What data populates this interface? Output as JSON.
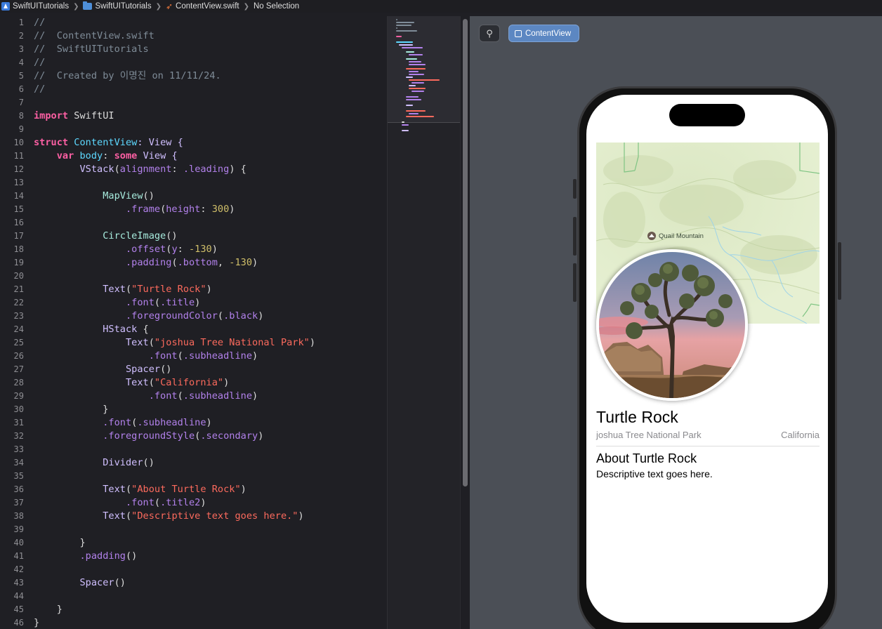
{
  "breadcrumb": {
    "project": "SwiftUITutorials",
    "folder": "SwiftUITutorials",
    "file": "ContentView.swift",
    "selection": "No Selection",
    "separator": "❯"
  },
  "editor": {
    "line_numbers": [
      "1",
      "2",
      "3",
      "4",
      "5",
      "6",
      "7",
      "8",
      "9",
      "10",
      "11",
      "12",
      "13",
      "14",
      "15",
      "16",
      "17",
      "18",
      "19",
      "20",
      "21",
      "22",
      "23",
      "24",
      "25",
      "26",
      "27",
      "28",
      "29",
      "30",
      "31",
      "32",
      "33",
      "34",
      "35",
      "36",
      "37",
      "38",
      "39",
      "40",
      "41",
      "42",
      "43",
      "44",
      "45",
      "46"
    ],
    "code": {
      "l1": "//",
      "l2": "//  ContentView.swift",
      "l3": "//  SwiftUITutorials",
      "l4": "//",
      "l5": "//  Created by 이명진 on 11/11/24.",
      "l6": "//",
      "import_kw": "import",
      "import_mod": "SwiftUI",
      "struct_kw": "struct",
      "struct_name": "ContentView",
      "colon_view": ": View {",
      "var_kw": "var",
      "body_name": "body",
      "some_kw": "some",
      "view_rest": "View {",
      "vstack": "VStack",
      "alignment_label": "alignment",
      "leading": ".leading",
      "mapview": "MapView",
      "frame": ".frame",
      "height_label": "height",
      "height_val": "300",
      "circleimage": "CircleImage",
      "offset": ".offset",
      "y_label": "y",
      "offset_val": "-130",
      "padding": ".padding",
      "bottom": ".bottom",
      "padding_val": "-130",
      "text_fn": "Text",
      "turtle_rock": "\"Turtle Rock\"",
      "font": ".font",
      "title": ".title",
      "fg_color": ".foregroundColor",
      "black": ".black",
      "hstack": "HStack",
      "park_str": "\"joshua Tree National Park\"",
      "subheadline": ".subheadline",
      "spacer": "Spacer",
      "california_str": "\"California\"",
      "fg_style": ".foregroundStyle",
      "secondary": ".secondary",
      "divider": "Divider",
      "about_str": "\"About Turtle Rock\"",
      "title2": ".title2",
      "desc_str": "\"Descriptive text goes here.\"",
      "padding_plain": ".padding",
      "spacer2": "Spacer"
    }
  },
  "canvas": {
    "pin_icon": "pin-icon",
    "preview_button": "ContentView"
  },
  "preview": {
    "map_label": "Quail Mountain",
    "title": "Turtle Rock",
    "park": "joshua Tree National Park",
    "state": "California",
    "about_title": "About Turtle Rock",
    "description": "Descriptive text goes here."
  },
  "colors": {
    "keyword": "#fc5fa3",
    "string": "#fc6a5d",
    "number": "#d0bf69",
    "accent_button": "#5c87c2"
  }
}
